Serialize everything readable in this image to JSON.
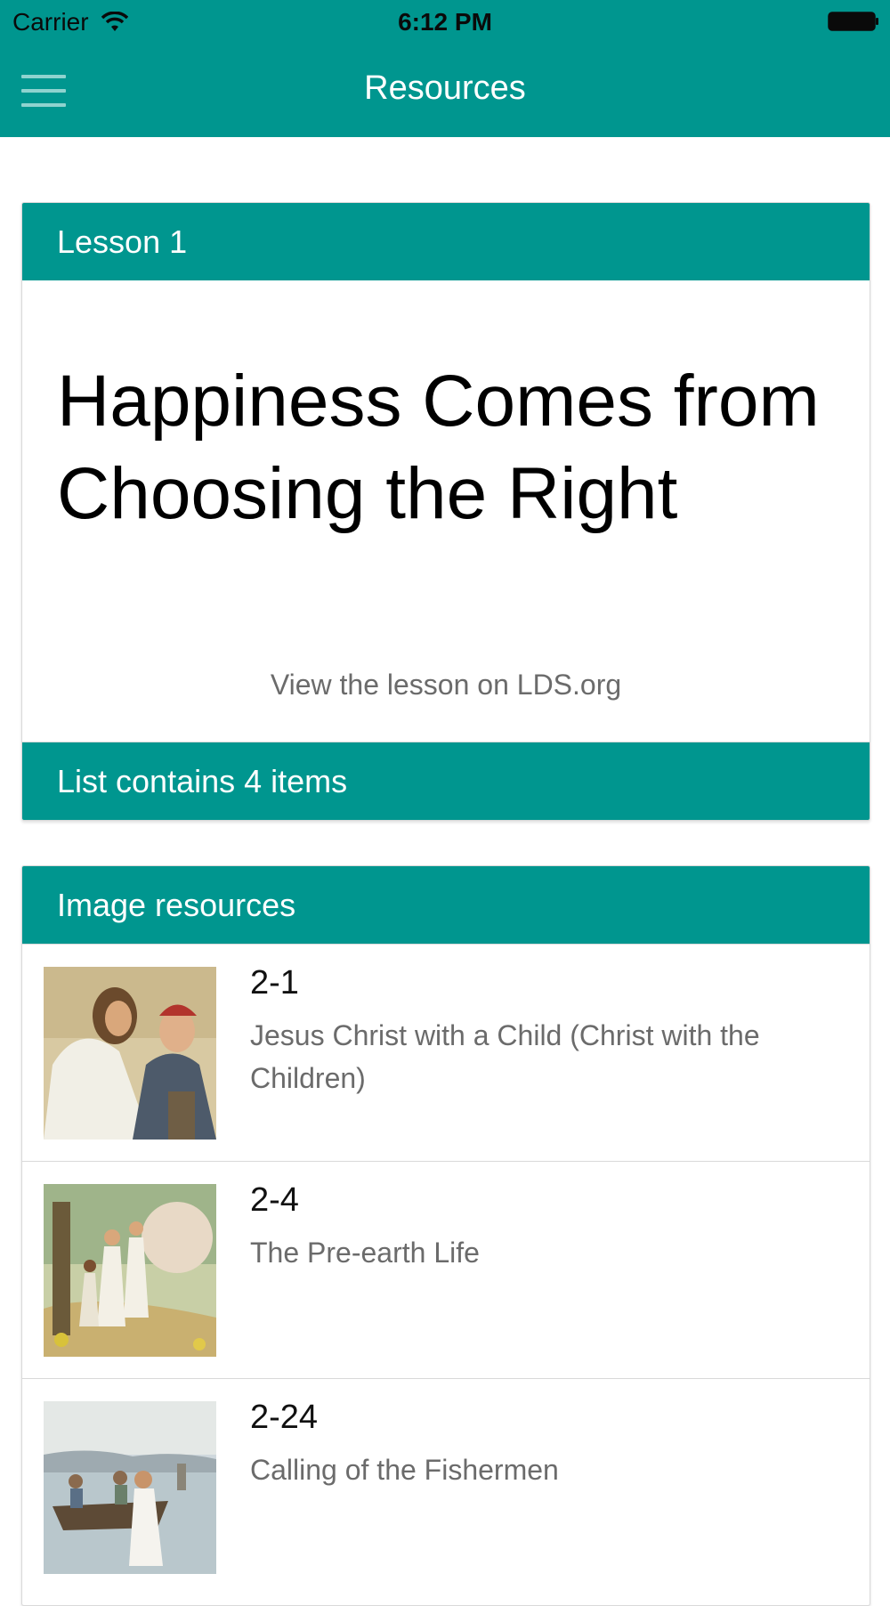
{
  "status_bar": {
    "carrier": "Carrier",
    "time": "6:12 PM"
  },
  "nav": {
    "title": "Resources",
    "menu_icon": "hamburger-menu-icon"
  },
  "lesson": {
    "header": "Lesson 1",
    "title": "Happiness Comes from Choosing the Right",
    "link": "View the lesson on LDS.org",
    "list_footer": "List contains 4 items"
  },
  "image_resources": {
    "header": "Image resources",
    "items": [
      {
        "code": "2-1",
        "title": "Jesus Christ with a Child (Christ with the Children)"
      },
      {
        "code": "2-4",
        "title": "The Pre-earth Life"
      },
      {
        "code": "2-24",
        "title": "Calling of the Fishermen"
      }
    ]
  },
  "colors": {
    "accent": "#00968f",
    "subtitle_gray": "#6b6b6b"
  }
}
